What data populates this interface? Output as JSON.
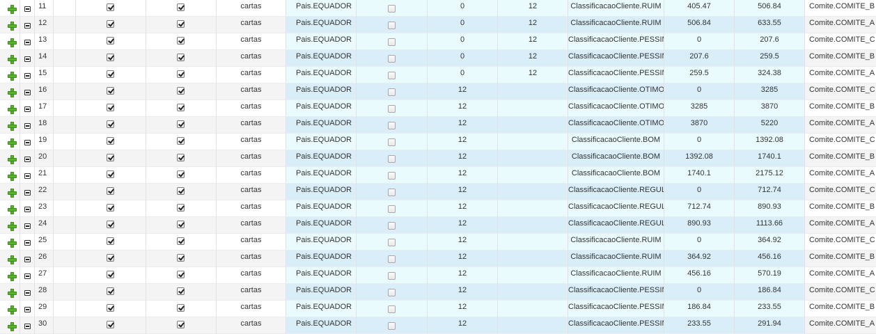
{
  "rows": [
    {
      "num": "11",
      "text": "cartas",
      "pais": "Pais.EQUADOR",
      "v1": "0",
      "v2": "12",
      "classificacao": "ClassificacaoCliente.RUIM",
      "min": "405.47",
      "max": "506.84",
      "comite": "Comite.COMITE_B"
    },
    {
      "num": "12",
      "text": "cartas",
      "pais": "Pais.EQUADOR",
      "v1": "0",
      "v2": "12",
      "classificacao": "ClassificacaoCliente.RUIM",
      "min": "506.84",
      "max": "633.55",
      "comite": "Comite.COMITE_A"
    },
    {
      "num": "13",
      "text": "cartas",
      "pais": "Pais.EQUADOR",
      "v1": "0",
      "v2": "12",
      "classificacao": "ClassificacaoCliente.PESSIM",
      "min": "0",
      "max": "207.6",
      "comite": "Comite.COMITE_C"
    },
    {
      "num": "14",
      "text": "cartas",
      "pais": "Pais.EQUADOR",
      "v1": "0",
      "v2": "12",
      "classificacao": "ClassificacaoCliente.PESSIM",
      "min": "207.6",
      "max": "259.5",
      "comite": "Comite.COMITE_B"
    },
    {
      "num": "15",
      "text": "cartas",
      "pais": "Pais.EQUADOR",
      "v1": "0",
      "v2": "12",
      "classificacao": "ClassificacaoCliente.PESSIM",
      "min": "259.5",
      "max": "324.38",
      "comite": "Comite.COMITE_A"
    },
    {
      "num": "16",
      "text": "cartas",
      "pais": "Pais.EQUADOR",
      "v1": "12",
      "v2": "",
      "classificacao": "ClassificacaoCliente.OTIMO",
      "min": "0",
      "max": "3285",
      "comite": "Comite.COMITE_C"
    },
    {
      "num": "17",
      "text": "cartas",
      "pais": "Pais.EQUADOR",
      "v1": "12",
      "v2": "",
      "classificacao": "ClassificacaoCliente.OTIMO",
      "min": "3285",
      "max": "3870",
      "comite": "Comite.COMITE_B"
    },
    {
      "num": "18",
      "text": "cartas",
      "pais": "Pais.EQUADOR",
      "v1": "12",
      "v2": "",
      "classificacao": "ClassificacaoCliente.OTIMO",
      "min": "3870",
      "max": "5220",
      "comite": "Comite.COMITE_A"
    },
    {
      "num": "19",
      "text": "cartas",
      "pais": "Pais.EQUADOR",
      "v1": "12",
      "v2": "",
      "classificacao": "ClassificacaoCliente.BOM",
      "min": "0",
      "max": "1392.08",
      "comite": "Comite.COMITE_C"
    },
    {
      "num": "20",
      "text": "cartas",
      "pais": "Pais.EQUADOR",
      "v1": "12",
      "v2": "",
      "classificacao": "ClassificacaoCliente.BOM",
      "min": "1392.08",
      "max": "1740.1",
      "comite": "Comite.COMITE_B"
    },
    {
      "num": "21",
      "text": "cartas",
      "pais": "Pais.EQUADOR",
      "v1": "12",
      "v2": "",
      "classificacao": "ClassificacaoCliente.BOM",
      "min": "1740.1",
      "max": "2175.12",
      "comite": "Comite.COMITE_A"
    },
    {
      "num": "22",
      "text": "cartas",
      "pais": "Pais.EQUADOR",
      "v1": "12",
      "v2": "",
      "classificacao": "ClassificacaoCliente.REGULA",
      "min": "0",
      "max": "712.74",
      "comite": "Comite.COMITE_C"
    },
    {
      "num": "23",
      "text": "cartas",
      "pais": "Pais.EQUADOR",
      "v1": "12",
      "v2": "",
      "classificacao": "ClassificacaoCliente.REGULA",
      "min": "712.74",
      "max": "890.93",
      "comite": "Comite.COMITE_B"
    },
    {
      "num": "24",
      "text": "cartas",
      "pais": "Pais.EQUADOR",
      "v1": "12",
      "v2": "",
      "classificacao": "ClassificacaoCliente.REGULA",
      "min": "890.93",
      "max": "1113.66",
      "comite": "Comite.COMITE_A"
    },
    {
      "num": "25",
      "text": "cartas",
      "pais": "Pais.EQUADOR",
      "v1": "12",
      "v2": "",
      "classificacao": "ClassificacaoCliente.RUIM",
      "min": "0",
      "max": "364.92",
      "comite": "Comite.COMITE_C"
    },
    {
      "num": "26",
      "text": "cartas",
      "pais": "Pais.EQUADOR",
      "v1": "12",
      "v2": "",
      "classificacao": "ClassificacaoCliente.RUIM",
      "min": "364.92",
      "max": "456.16",
      "comite": "Comite.COMITE_B"
    },
    {
      "num": "27",
      "text": "cartas",
      "pais": "Pais.EQUADOR",
      "v1": "12",
      "v2": "",
      "classificacao": "ClassificacaoCliente.RUIM",
      "min": "456.16",
      "max": "570.19",
      "comite": "Comite.COMITE_A"
    },
    {
      "num": "28",
      "text": "cartas",
      "pais": "Pais.EQUADOR",
      "v1": "12",
      "v2": "",
      "classificacao": "ClassificacaoCliente.PESSIM",
      "min": "0",
      "max": "186.84",
      "comite": "Comite.COMITE_C"
    },
    {
      "num": "29",
      "text": "cartas",
      "pais": "Pais.EQUADOR",
      "v1": "12",
      "v2": "",
      "classificacao": "ClassificacaoCliente.PESSIM",
      "min": "186.84",
      "max": "233.55",
      "comite": "Comite.COMITE_B"
    },
    {
      "num": "30",
      "text": "cartas",
      "pais": "Pais.EQUADOR",
      "v1": "12",
      "v2": "",
      "classificacao": "ClassificacaoCliente.PESSIM",
      "min": "233.55",
      "max": "291.94",
      "comite": "Comite.COMITE_A"
    }
  ]
}
